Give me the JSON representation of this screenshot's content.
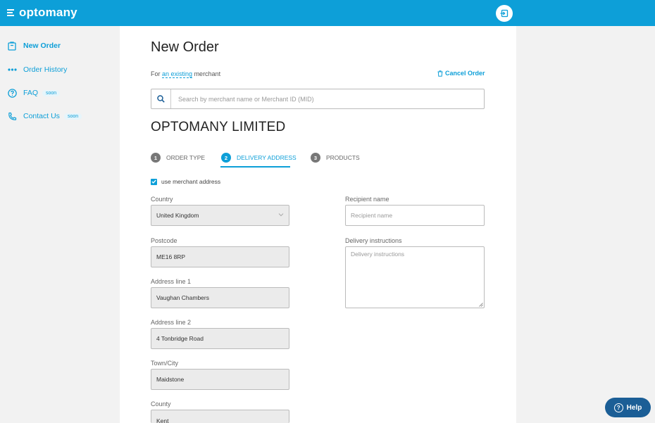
{
  "app": {
    "logo": "optomany"
  },
  "sidebar": {
    "items": [
      {
        "label": "New Order",
        "icon": "clipboard-icon",
        "badge": ""
      },
      {
        "label": "Order History",
        "icon": "dots-icon",
        "badge": ""
      },
      {
        "label": "FAQ",
        "icon": "question-icon",
        "badge": "soon"
      },
      {
        "label": "Contact Us",
        "icon": "phone-icon",
        "badge": "soon"
      }
    ]
  },
  "main": {
    "title": "New Order",
    "for_prefix": "For",
    "for_link": "an existing",
    "for_suffix": "merchant",
    "cancel_label": "Cancel Order",
    "search_placeholder": "Search by merchant name or Merchant ID (MID)",
    "merchant_name": "OPTOMANY LIMITED",
    "steps": [
      {
        "num": "1",
        "label": "ORDER TYPE"
      },
      {
        "num": "2",
        "label": "DELIVERY ADDRESS"
      },
      {
        "num": "3",
        "label": "PRODUCTS"
      }
    ],
    "use_merchant_address": "use merchant address",
    "form": {
      "country_label": "Country",
      "country_value": "United Kingdom",
      "postcode_label": "Postcode",
      "postcode_value": "ME16 8RP",
      "address1_label": "Address line 1",
      "address1_value": "Vaughan Chambers",
      "address2_label": "Address line 2",
      "address2_value": "4 Tonbridge Road",
      "town_label": "Town/City",
      "town_value": "Maidstone",
      "county_label": "County",
      "county_value": "Kent",
      "recipient_label": "Recipient name",
      "recipient_placeholder": "Recipient name",
      "instructions_label": "Delivery instructions",
      "instructions_placeholder": "Delivery instructions"
    }
  },
  "help": {
    "label": "Help"
  },
  "colors": {
    "brand": "#0d9fd8",
    "help_button": "#1b5e96"
  }
}
